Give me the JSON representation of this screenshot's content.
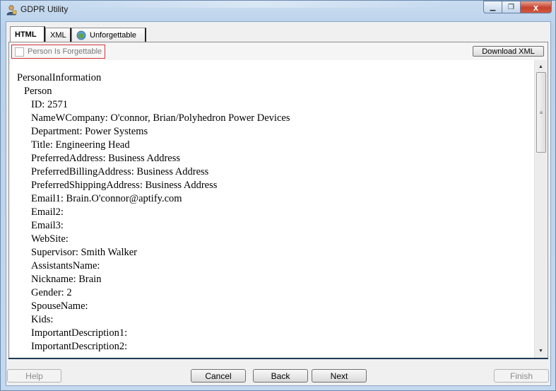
{
  "window": {
    "title": "GDPR Utility",
    "controls": {
      "minimize": "▁",
      "maximize": "❐",
      "close": "x"
    }
  },
  "tabs": [
    {
      "label": "HTML",
      "active": true
    },
    {
      "label": "XML",
      "active": false
    },
    {
      "label": "Unforgettable",
      "active": false,
      "icon": "globe-icon"
    }
  ],
  "toolbar": {
    "forgettable_label": "Person Is Forgettable",
    "forgettable_checked": false,
    "download_label": "Download XML"
  },
  "content": {
    "lines": [
      {
        "text": "PersonalInformation",
        "level": 0
      },
      {
        "text": "Person",
        "level": 1
      },
      {
        "text": "ID: 2571",
        "level": 2
      },
      {
        "text": "NameWCompany: O'connor, Brian/Polyhedron Power Devices",
        "level": 2
      },
      {
        "text": "Department: Power Systems",
        "level": 2
      },
      {
        "text": "Title: Engineering Head",
        "level": 2
      },
      {
        "text": "PreferredAddress: Business Address",
        "level": 2
      },
      {
        "text": "PreferredBillingAddress: Business Address",
        "level": 2
      },
      {
        "text": "PreferredShippingAddress: Business Address",
        "level": 2
      },
      {
        "text": "Email1: Brain.O'connor@aptify.com",
        "level": 2
      },
      {
        "text": "Email2:",
        "level": 2
      },
      {
        "text": "Email3:",
        "level": 2
      },
      {
        "text": "WebSite:",
        "level": 2
      },
      {
        "text": "Supervisor: Smith Walker",
        "level": 2
      },
      {
        "text": "AssistantsName:",
        "level": 2
      },
      {
        "text": "Nickname: Brain",
        "level": 2
      },
      {
        "text": "Gender: 2",
        "level": 2
      },
      {
        "text": "SpouseName:",
        "level": 2
      },
      {
        "text": "Kids:",
        "level": 2
      },
      {
        "text": "ImportantDescription1:",
        "level": 2
      },
      {
        "text": "ImportantDescription2:",
        "level": 2
      }
    ]
  },
  "scrollbar": {
    "up_arrow": "▲",
    "down_arrow": "▼",
    "grip": "≡"
  },
  "footer": {
    "help": "Help",
    "cancel": "Cancel",
    "back": "Back",
    "next": "Next",
    "finish": "Finish"
  },
  "colors": {
    "highlight_border": "#d6333b",
    "panel_border": "#1f3a55"
  }
}
